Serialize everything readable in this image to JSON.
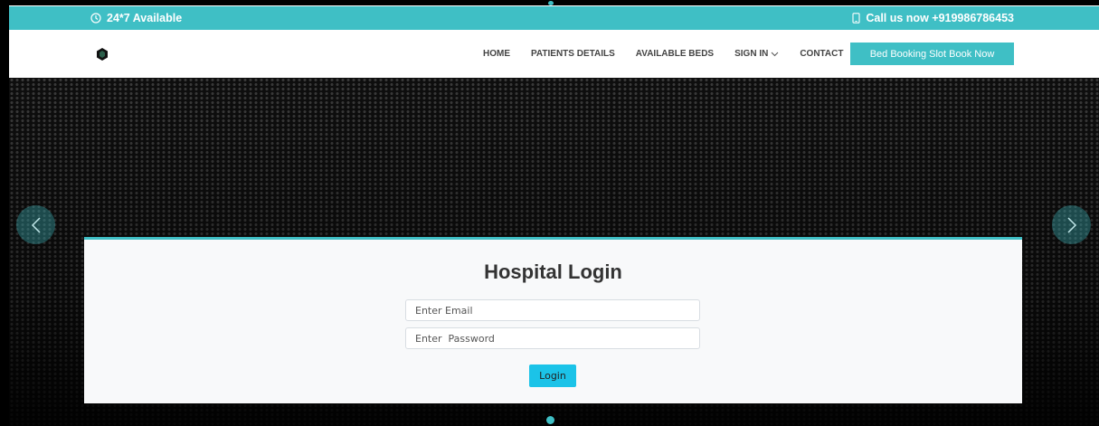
{
  "topbar": {
    "availability": "24*7 Available",
    "availability_icon": "clock-icon",
    "phone": "Call us now +919986786453",
    "phone_icon": "mobile-phone-icon"
  },
  "nav": {
    "items": [
      {
        "label": "HOME"
      },
      {
        "label": "PATIENTS DETAILS"
      },
      {
        "label": "AVAILABLE BEDS"
      },
      {
        "label": "SIGN IN",
        "icon": "chevron-down-icon"
      },
      {
        "label": "CONTACT"
      }
    ],
    "cta_label": "Bed Booking Slot Book Now"
  },
  "login": {
    "title": "Hospital Login",
    "email_placeholder": "Enter Email",
    "password_placeholder": "Enter  Password",
    "button_label": "Login"
  },
  "carousel": {
    "prev_icon": "chevron-left-icon",
    "next_icon": "chevron-right-icon",
    "active_slide": 1,
    "slide_count": 1
  },
  "colors": {
    "accent": "#3fbfc5",
    "login_button": "#1bc3e8",
    "hero_background": "#0e0e0e"
  }
}
